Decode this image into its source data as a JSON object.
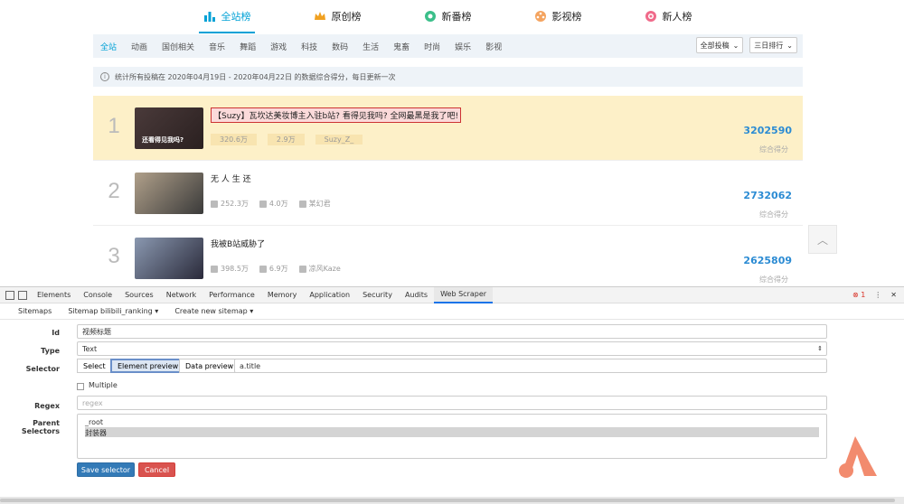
{
  "top_tabs": [
    {
      "label": "全站榜",
      "icon": "bar-chart-icon",
      "color": "#00a1d6",
      "active": true
    },
    {
      "label": "原创榜",
      "icon": "crown-icon",
      "color": "#f0a020",
      "active": false
    },
    {
      "label": "新番榜",
      "icon": "donut-icon",
      "color": "#3bbf8a",
      "active": false
    },
    {
      "label": "影视榜",
      "icon": "film-reel-icon",
      "color": "#f4a460",
      "active": false
    },
    {
      "label": "新人榜",
      "icon": "newcomer-icon",
      "color": "#f06a8a",
      "active": false
    }
  ],
  "categories": [
    "全站",
    "动画",
    "国创相关",
    "音乐",
    "舞蹈",
    "游戏",
    "科技",
    "数码",
    "生活",
    "鬼畜",
    "时尚",
    "娱乐",
    "影视"
  ],
  "dropdowns": {
    "type": "全部投稿",
    "range": "三日排行"
  },
  "notice": "统计所有投稿在 2020年04月19日 - 2020年04月22日 的数据综合得分，每日更新一次",
  "ranks": [
    {
      "num": "1",
      "title": "【Suzy】瓦坎达美妆博主入驻b站? 看得见我吗? 全网最黑是我了吧!",
      "thumb_caption": "还看得见我吗?",
      "plays": "320.6万",
      "danmaku": "2.9万",
      "author": "Suzy_Z_",
      "score": "3202590",
      "score_label": "综合得分"
    },
    {
      "num": "2",
      "title": "无 人 生 还",
      "thumb_caption": "",
      "plays": "252.3万",
      "danmaku": "4.0万",
      "author": "某幻君",
      "score": "2732062",
      "score_label": "综合得分"
    },
    {
      "num": "3",
      "title": "我被B站威胁了",
      "thumb_caption": "",
      "plays": "398.5万",
      "danmaku": "6.9万",
      "author": "凉风Kaze",
      "score": "2625809",
      "score_label": "综合得分"
    }
  ],
  "devtools": {
    "tabs": [
      "Elements",
      "Console",
      "Sources",
      "Network",
      "Performance",
      "Memory",
      "Application",
      "Security",
      "Audits",
      "Web Scraper"
    ],
    "active_tab": "Web Scraper",
    "error_count": "1"
  },
  "scraper_nav": {
    "sitemaps": "Sitemaps",
    "sitemap": "Sitemap bilibili_ranking",
    "create": "Create new sitemap"
  },
  "form": {
    "id_label": "Id",
    "id_value": "视频标题",
    "type_label": "Type",
    "type_value": "Text",
    "selector_label": "Selector",
    "select_btn": "Select",
    "element_preview_btn": "Element preview",
    "data_preview_btn": "Data preview",
    "selector_value": "a.title",
    "multiple_label": "Multiple",
    "regex_label": "Regex",
    "regex_placeholder": "regex",
    "parent_label": "Parent Selectors",
    "parents": [
      "_root",
      "封装器"
    ],
    "save_btn": "Save selector",
    "cancel_btn": "Cancel"
  }
}
